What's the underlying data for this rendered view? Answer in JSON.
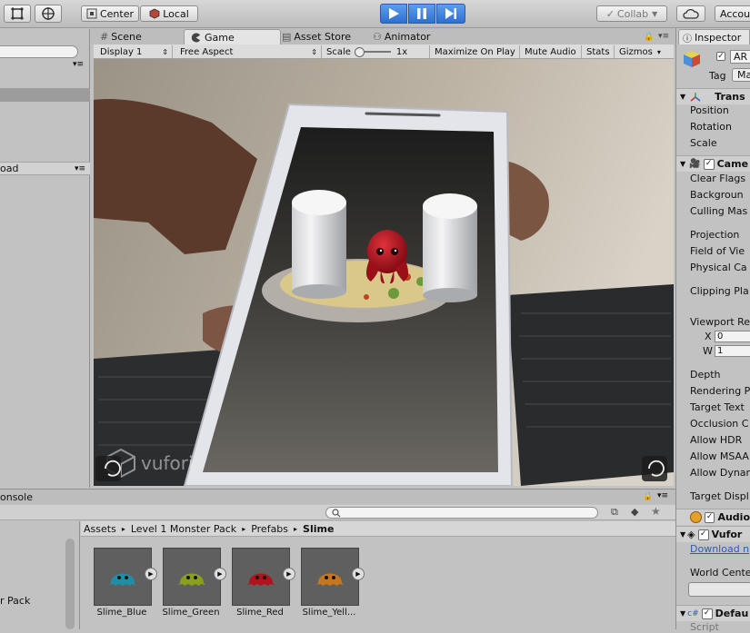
{
  "toolbar": {
    "center_label": "Center",
    "local_label": "Local",
    "collab_label": "Collab",
    "account_label": "Accou"
  },
  "tabs": {
    "scene": "Scene",
    "game": "Game",
    "asset_store": "Asset Store",
    "animator": "Animator",
    "inspector": "Inspector"
  },
  "game_view": {
    "display": "Display 1",
    "aspect": "Free Aspect",
    "scale_label": "Scale",
    "scale_value": "1x",
    "maximize": "Maximize On Play",
    "mute": "Mute Audio",
    "stats": "Stats",
    "gizmos": "Gizmos",
    "watermark": "vuforia"
  },
  "left_panel": {
    "load_label": "oad",
    "console_label": "onsole",
    "pack_label": "r Pack"
  },
  "project": {
    "breadcrumb": [
      "Assets",
      "Level 1 Monster Pack",
      "Prefabs",
      "Slime"
    ],
    "assets": [
      {
        "name": "Slime_Blue",
        "color": "#1f8fa8"
      },
      {
        "name": "Slime_Green",
        "color": "#8aa01c"
      },
      {
        "name": "Slime_Red",
        "color": "#b1121b"
      },
      {
        "name": "Slime_Yell...",
        "color": "#c8761c"
      }
    ]
  },
  "inspector": {
    "object_name": "AR",
    "tag_label": "Tag",
    "tag_value": "Ma",
    "transform": "Trans",
    "transform_fields": [
      "Position",
      "Rotation",
      "Scale"
    ],
    "camera": "Came",
    "camera_fields": [
      "Clear Flags",
      "Backgroun",
      "Culling Mas",
      "Projection",
      "Field of Vie",
      "Physical Ca",
      "Clipping Pla",
      "Viewport Re",
      "Depth",
      "Rendering P",
      "Target Text",
      "Occlusion C",
      "Allow HDR",
      "Allow MSAA",
      "Allow Dynar",
      "Target Displ"
    ],
    "viewport_x_label": "X",
    "viewport_x_value": "0",
    "viewport_w_label": "W",
    "viewport_w_value": "1",
    "audio": "Audio",
    "vuforia": "Vufor",
    "download_link": "Download n",
    "world_center": "World Cente",
    "default": "Defau",
    "script": "Script"
  },
  "colors": {
    "play_blue": "#2f6fd0",
    "link_blue": "#2a5db0"
  }
}
